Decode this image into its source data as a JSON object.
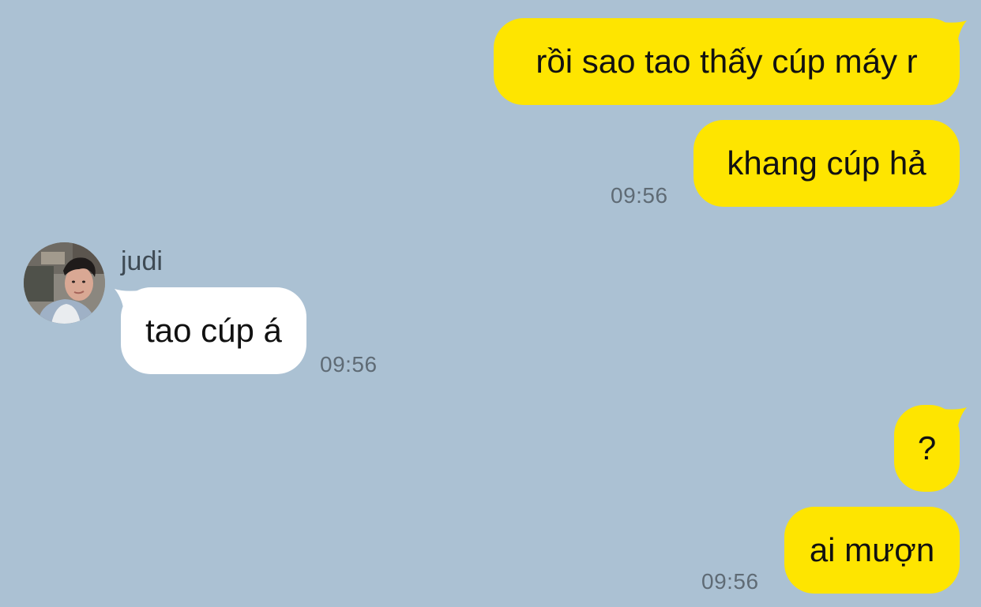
{
  "chat": {
    "colors": {
      "background": "#abc1d3",
      "my_bubble": "#fee500",
      "other_bubble": "#ffffff",
      "timestamp": "#5f6b75"
    },
    "contact": {
      "name": "judi",
      "avatar_icon": "profile-photo"
    },
    "messages": [
      {
        "from": "me",
        "text": "rồi sao tao thấy cúp máy r",
        "time": ""
      },
      {
        "from": "me",
        "text": "khang cúp hả",
        "time": "09:56"
      },
      {
        "from": "other",
        "text": "tao cúp á",
        "time": "09:56"
      },
      {
        "from": "me",
        "text": "?",
        "time": ""
      },
      {
        "from": "me",
        "text": "ai mượn",
        "time": "09:56"
      }
    ]
  }
}
